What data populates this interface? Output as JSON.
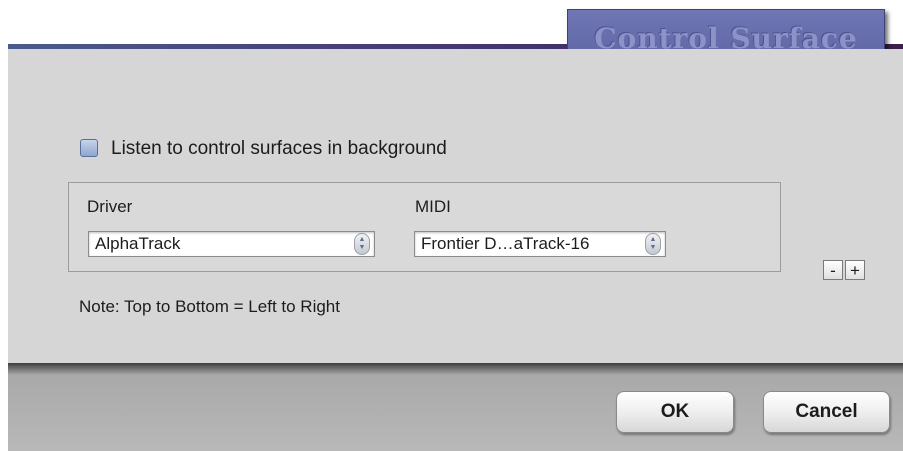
{
  "window": {
    "title": "Control Surface",
    "colors": {
      "title_tab": "#6269a8",
      "title_text": "#8d93c8",
      "panel": "#d6d6d6",
      "footer": "#b0b0b0"
    }
  },
  "options": {
    "listen_background": {
      "label": "Listen to control surfaces in background",
      "checked": false
    }
  },
  "surface": {
    "driver_label": "Driver",
    "driver_value": "AlphaTrack",
    "midi_label": "MIDI",
    "midi_value": "Frontier D…aTrack-16",
    "remove_label": "-",
    "add_label": "+",
    "icons": {
      "select_stepper": "up-down-arrows-icon"
    }
  },
  "note": "Note: Top to Bottom = Left to Right",
  "buttons": {
    "ok": "OK",
    "cancel": "Cancel"
  }
}
